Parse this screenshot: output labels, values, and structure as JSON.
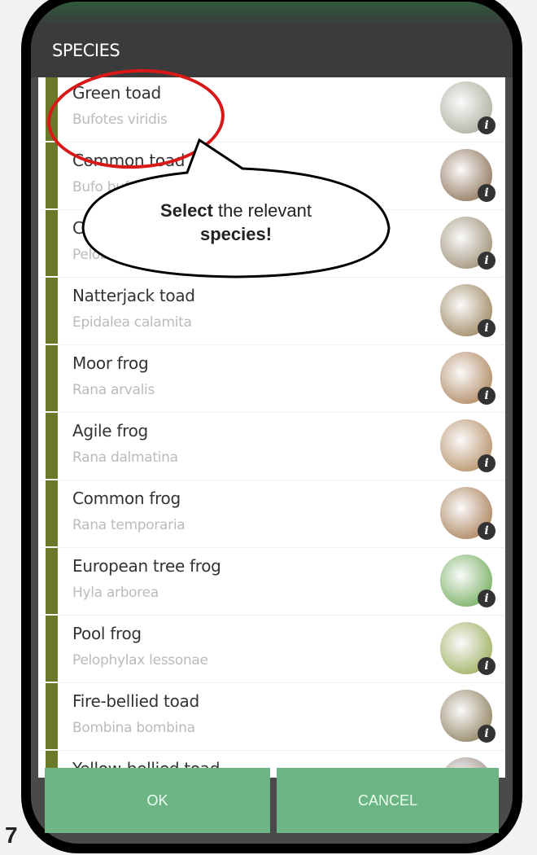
{
  "dialog": {
    "title": "SPECIES",
    "ok_label": "OK",
    "cancel_label": "CANCEL"
  },
  "species": [
    {
      "name": "Green toad",
      "scientific": "Bufotes viridis",
      "photo_color": "#9aa08a"
    },
    {
      "name": "Common toad",
      "scientific": "Bufo bufo",
      "photo_color": "#7a5a3a"
    },
    {
      "name": "Common spadefoot",
      "scientific": "Pelobates fuscus",
      "photo_color": "#8a7a5a"
    },
    {
      "name": "Natterjack toad",
      "scientific": "Epidalea calamita",
      "photo_color": "#8a7040"
    },
    {
      "name": "Moor frog",
      "scientific": "Rana arvalis",
      "photo_color": "#a07040"
    },
    {
      "name": "Agile frog",
      "scientific": "Rana dalmatina",
      "photo_color": "#a87a48"
    },
    {
      "name": "Common frog",
      "scientific": "Rana temporaria",
      "photo_color": "#9a6838"
    },
    {
      "name": "European tree frog",
      "scientific": "Hyla arborea",
      "photo_color": "#5aa040"
    },
    {
      "name": "Pool frog",
      "scientific": "Pelophylax lessonae",
      "photo_color": "#8aa040"
    },
    {
      "name": "Fire-bellied toad",
      "scientific": "Bombina bombina",
      "photo_color": "#7a6a40"
    },
    {
      "name": "Yellow-bellied toad",
      "scientific": "",
      "photo_color": "#8a7a70"
    }
  ],
  "callout": {
    "bold1": "Select",
    "text": " the relevant",
    "bold2": "species!"
  },
  "step_number": "7",
  "colors": {
    "accent_bar": "#6b7a2a",
    "button": "#6db585",
    "header": "#3b3b3b",
    "highlight_ring": "#d91818"
  }
}
